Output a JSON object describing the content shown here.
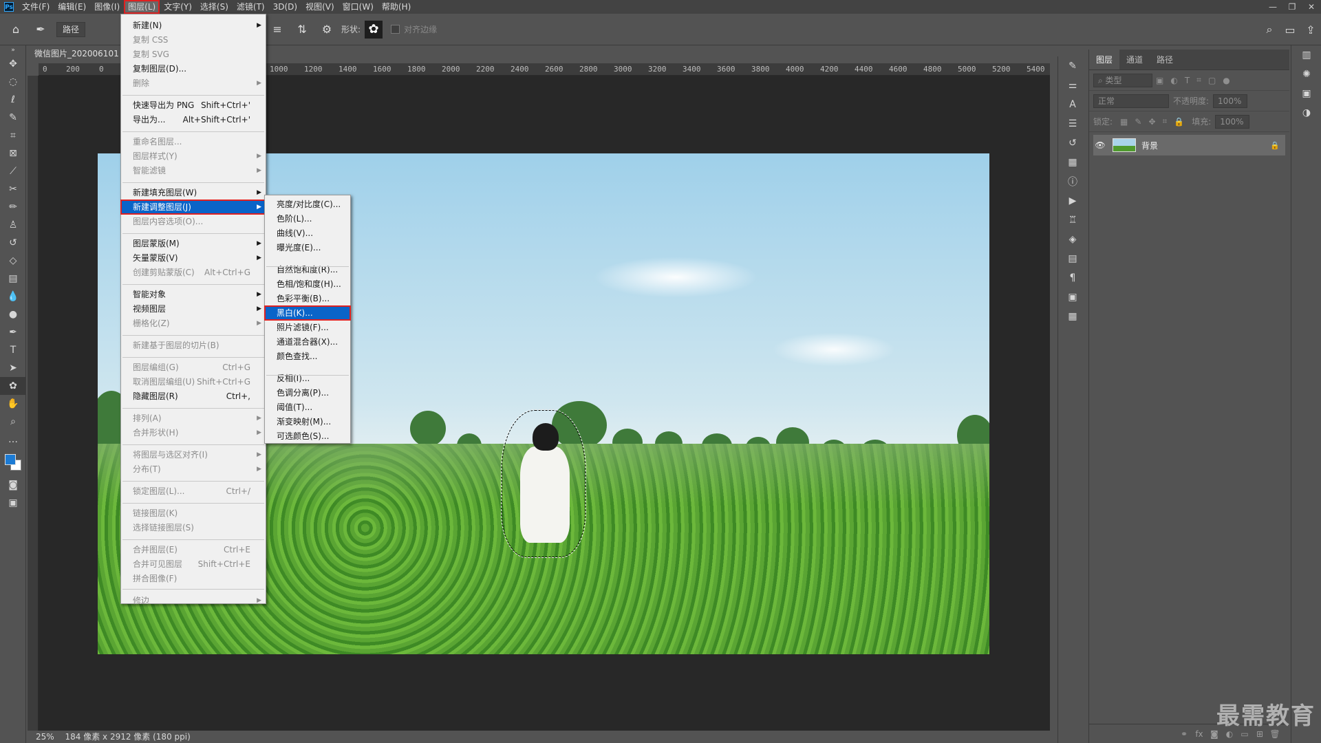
{
  "menubar": {
    "logo": "Ps",
    "items": [
      "文件(F)",
      "编辑(E)",
      "图像(I)",
      "图层(L)",
      "文字(Y)",
      "选择(S)",
      "滤镜(T)",
      "3D(D)",
      "视图(V)",
      "窗口(W)",
      "帮助(H)"
    ],
    "window_controls": [
      "—",
      "❐",
      "✕"
    ]
  },
  "options_bar": {
    "mode_value": "路径",
    "shape_label": "形状:",
    "align_edges_label": "对齐边缘"
  },
  "document": {
    "tab_title": "微信图片_202006101",
    "status_zoom": "25%",
    "status_info": "184 像素 x 2912 像素 (180 ppi)"
  },
  "ruler_top": {
    "labels": [
      "0",
      "200",
      "0",
      "1000",
      "1200",
      "1400",
      "1600",
      "1800",
      "2000",
      "2200",
      "2400",
      "2600",
      "2800",
      "3000",
      "3200",
      "3400",
      "3600",
      "3800",
      "4000",
      "4200",
      "4400",
      "4600",
      "4800",
      "5000",
      "5200",
      "5400"
    ]
  },
  "layer_menu": {
    "items": [
      {
        "label": "新建(N)",
        "shortcut": "",
        "submenu": true,
        "disabled": false
      },
      {
        "label": "复制 CSS",
        "shortcut": "",
        "submenu": false,
        "disabled": true
      },
      {
        "label": "复制 SVG",
        "shortcut": "",
        "submenu": false,
        "disabled": true
      },
      {
        "label": "复制图层(D)...",
        "shortcut": "",
        "submenu": false,
        "disabled": false
      },
      {
        "label": "删除",
        "shortcut": "",
        "submenu": true,
        "disabled": true
      },
      {
        "label": "快速导出为 PNG",
        "shortcut": "Shift+Ctrl+'",
        "submenu": false,
        "disabled": false
      },
      {
        "label": "导出为...",
        "shortcut": "Alt+Shift+Ctrl+'",
        "submenu": false,
        "disabled": false
      },
      {
        "label": "重命名图层...",
        "shortcut": "",
        "submenu": false,
        "disabled": true
      },
      {
        "label": "图层样式(Y)",
        "shortcut": "",
        "submenu": true,
        "disabled": true
      },
      {
        "label": "智能滤镜",
        "shortcut": "",
        "submenu": true,
        "disabled": true
      },
      {
        "label": "新建填充图层(W)",
        "shortcut": "",
        "submenu": true,
        "disabled": false
      },
      {
        "label": "新建调整图层(J)",
        "shortcut": "",
        "submenu": true,
        "disabled": false
      },
      {
        "label": "图层内容选项(O)...",
        "shortcut": "",
        "submenu": false,
        "disabled": true
      },
      {
        "label": "图层蒙版(M)",
        "shortcut": "",
        "submenu": true,
        "disabled": false
      },
      {
        "label": "矢量蒙版(V)",
        "shortcut": "",
        "submenu": true,
        "disabled": false
      },
      {
        "label": "创建剪贴蒙版(C)",
        "shortcut": "Alt+Ctrl+G",
        "submenu": false,
        "disabled": true
      },
      {
        "label": "智能对象",
        "shortcut": "",
        "submenu": true,
        "disabled": false
      },
      {
        "label": "视频图层",
        "shortcut": "",
        "submenu": true,
        "disabled": false
      },
      {
        "label": "栅格化(Z)",
        "shortcut": "",
        "submenu": true,
        "disabled": true
      },
      {
        "label": "新建基于图层的切片(B)",
        "shortcut": "",
        "submenu": false,
        "disabled": true
      },
      {
        "label": "图层编组(G)",
        "shortcut": "Ctrl+G",
        "submenu": false,
        "disabled": true
      },
      {
        "label": "取消图层编组(U)",
        "shortcut": "Shift+Ctrl+G",
        "submenu": false,
        "disabled": true
      },
      {
        "label": "隐藏图层(R)",
        "shortcut": "Ctrl+,",
        "submenu": false,
        "disabled": false
      },
      {
        "label": "排列(A)",
        "shortcut": "",
        "submenu": true,
        "disabled": true
      },
      {
        "label": "合并形状(H)",
        "shortcut": "",
        "submenu": true,
        "disabled": true
      },
      {
        "label": "将图层与选区对齐(I)",
        "shortcut": "",
        "submenu": true,
        "disabled": true
      },
      {
        "label": "分布(T)",
        "shortcut": "",
        "submenu": true,
        "disabled": true
      },
      {
        "label": "锁定图层(L)...",
        "shortcut": "Ctrl+/",
        "submenu": false,
        "disabled": true
      },
      {
        "label": "链接图层(K)",
        "shortcut": "",
        "submenu": false,
        "disabled": true
      },
      {
        "label": "选择链接图层(S)",
        "shortcut": "",
        "submenu": false,
        "disabled": true
      },
      {
        "label": "合并图层(E)",
        "shortcut": "Ctrl+E",
        "submenu": false,
        "disabled": true
      },
      {
        "label": "合并可见图层",
        "shortcut": "Shift+Ctrl+E",
        "submenu": false,
        "disabled": true
      },
      {
        "label": "拼合图像(F)",
        "shortcut": "",
        "submenu": false,
        "disabled": true
      },
      {
        "label": "修边",
        "shortcut": "",
        "submenu": true,
        "disabled": true
      }
    ]
  },
  "adjustment_menu": {
    "items": [
      "亮度/对比度(C)...",
      "色阶(L)...",
      "曲线(V)...",
      "曝光度(E)...",
      "自然饱和度(R)...",
      "色相/饱和度(H)...",
      "色彩平衡(B)...",
      "黑白(K)...",
      "照片滤镜(F)...",
      "通道混合器(X)...",
      "颜色查找...",
      "反相(I)...",
      "色调分离(P)...",
      "阈值(T)...",
      "渐变映射(M)...",
      "可选颜色(S)..."
    ]
  },
  "layers_panel": {
    "tabs": [
      "图层",
      "通道",
      "路径"
    ],
    "filter_label": "类型",
    "blend_mode": "正常",
    "opacity_label": "不透明度:",
    "opacity_value": "100%",
    "lock_label": "锁定:",
    "fill_label": "填充:",
    "fill_value": "100%",
    "layers": [
      {
        "name": "背景",
        "visible": true,
        "locked": true
      }
    ]
  },
  "watermark": "最需教育",
  "colors": {
    "foreground": "#1c7bd4",
    "background": "#ffffff",
    "highlight": "#0a64c8",
    "annotation_red": "#e02020"
  }
}
